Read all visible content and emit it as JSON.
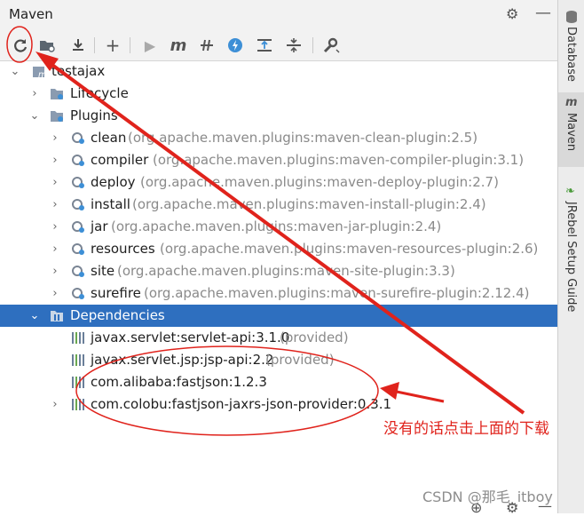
{
  "window": {
    "title": "Maven"
  },
  "tree": {
    "root": "testajax",
    "lifecycle": "Lifecycle",
    "plugins": "Plugins",
    "plugin_items": [
      {
        "name": "clean",
        "coord": "(org.apache.maven.plugins:maven-clean-plugin:2.5)"
      },
      {
        "name": "compiler",
        "coord": "(org.apache.maven.plugins:maven-compiler-plugin:3.1)"
      },
      {
        "name": "deploy",
        "coord": "(org.apache.maven.plugins:maven-deploy-plugin:2.7)"
      },
      {
        "name": "install",
        "coord": "(org.apache.maven.plugins:maven-install-plugin:2.4)"
      },
      {
        "name": "jar",
        "coord": "(org.apache.maven.plugins:maven-jar-plugin:2.4)"
      },
      {
        "name": "resources",
        "coord": "(org.apache.maven.plugins:maven-resources-plugin:2.6)"
      },
      {
        "name": "site",
        "coord": "(org.apache.maven.plugins:maven-site-plugin:3.3)"
      },
      {
        "name": "surefire",
        "coord": "(org.apache.maven.plugins:maven-surefire-plugin:2.12.4)"
      }
    ],
    "dependencies": "Dependencies",
    "dependency_items": [
      {
        "name": "javax.servlet:servlet-api:3.1.0",
        "scope": "(provided)"
      },
      {
        "name": "javax.servlet.jsp:jsp-api:2.2",
        "scope": "(provided)"
      },
      {
        "name": "com.alibaba:fastjson:1.2.3",
        "scope": ""
      },
      {
        "name": "com.colobu:fastjson-jaxrs-json-provider:0.3.1",
        "scope": ""
      }
    ]
  },
  "sidebar": {
    "tabs": [
      "Database",
      "Maven",
      "JRebel Setup Guide"
    ]
  },
  "annotation": {
    "text": "没有的话点击上面的下载"
  },
  "watermark": "CSDN @那毛_itboy",
  "colors": {
    "selection": "#2e6fbf",
    "annotation_red": "#e0231c",
    "maven_m": "#c23b3b"
  }
}
